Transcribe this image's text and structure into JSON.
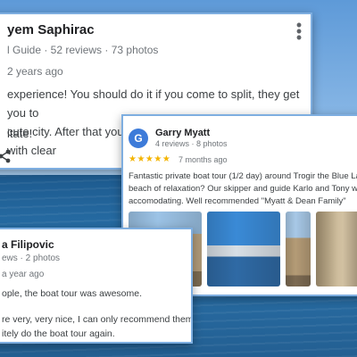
{
  "reviews": [
    {
      "name": "yem Saphirac",
      "meta": "l Guide · 52 reviews · 73 photos",
      "date": "2 years ago",
      "text_lines": [
        "experience! You should do it if you come to split, they get you to",
        "cute city. After that you go swimming to beautiful beaches with clear"
      ],
      "text_tail": "itate!",
      "icons": {
        "more": "more-vert-icon",
        "share": "share-icon"
      }
    },
    {
      "avatar_initial": "G",
      "name": "Garry Myatt",
      "meta": "4 reviews · 8 photos",
      "stars": "★★★★★",
      "rating": 5,
      "date": "7 months ago",
      "text_lines": [
        "Fantastic private boat tour (1/2 day) around Trogir the Blue La",
        "beach of relaxation? Our skipper and guide Karlo and Tony we",
        "accomodating. Well recommended \"Myatt & Dean Family\""
      ],
      "photos": [
        "photo-old-town-street",
        "photo-harbor-boats",
        "photo-stone-facade",
        "photo-narrow-alley"
      ],
      "colors": {
        "avatar": "#3d7bd9",
        "star": "#f4b400"
      }
    },
    {
      "name": "a Filipovic",
      "meta": "ews · 2 photos",
      "date": "a year ago",
      "text_lines": [
        "ople, the boat tour was awesome.",
        "re very, very nice, I can only recommend them.",
        "itely do the boat tour again."
      ]
    }
  ],
  "colors": {
    "card_border": "#7eaee0",
    "meta_text": "#70757a"
  }
}
